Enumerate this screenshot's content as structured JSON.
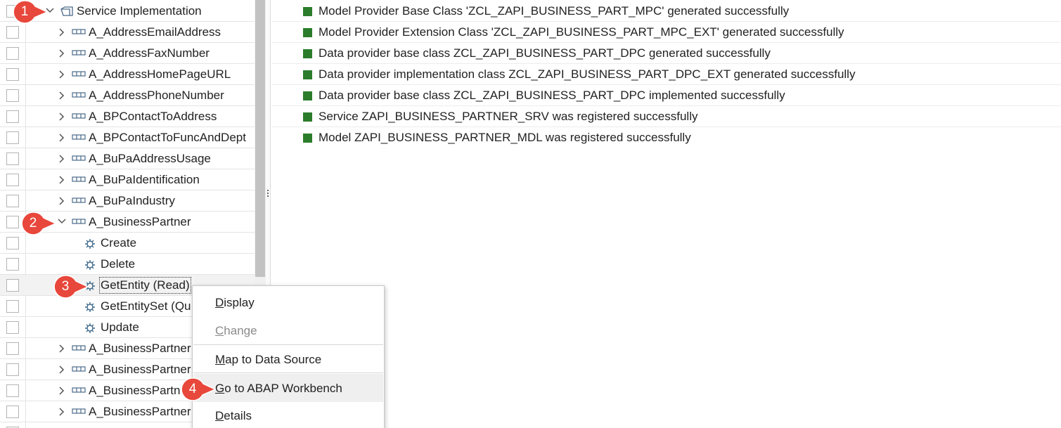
{
  "tree": {
    "root": {
      "label": "Service Implementation",
      "icon": "service-folder-icon"
    },
    "entities_before": [
      "A_AddressEmailAddress",
      "A_AddressFaxNumber",
      "A_AddressHomePageURL",
      "A_AddressPhoneNumber",
      "A_BPContactToAddress",
      "A_BPContactToFuncAndDept",
      "A_BuPaAddressUsage",
      "A_BuPaIdentification",
      "A_BuPaIndustry"
    ],
    "expanded_entity": "A_BusinessPartner",
    "operations": [
      "Create",
      "Delete",
      "GetEntity (Read)",
      "GetEntitySet (Qu",
      "Update"
    ],
    "selected_operation": "GetEntity (Read)",
    "entities_after": [
      "A_BusinessPartner",
      "A_BusinessPartner",
      "A_BusinessPartn",
      "A_BusinessPartner"
    ]
  },
  "messages": [
    {
      "status": "success",
      "text": "Model Provider Base Class 'ZCL_ZAPI_BUSINESS_PART_MPC' generated successfully"
    },
    {
      "status": "success",
      "text": "Model Provider Extension Class 'ZCL_ZAPI_BUSINESS_PART_MPC_EXT' generated successfully"
    },
    {
      "status": "success",
      "text": "Data provider base class ZCL_ZAPI_BUSINESS_PART_DPC generated successfully"
    },
    {
      "status": "success",
      "text": "Data provider implementation class ZCL_ZAPI_BUSINESS_PART_DPC_EXT generated successfully"
    },
    {
      "status": "success",
      "text": "Data provider base class ZCL_ZAPI_BUSINESS_PART_DPC implemented successfully"
    },
    {
      "status": "success",
      "text": "Service ZAPI_BUSINESS_PARTNER_SRV was registered successfully"
    },
    {
      "status": "success",
      "text": "Model ZAPI_BUSINESS_PARTNER_MDL was registered successfully"
    }
  ],
  "context_menu": {
    "display": {
      "accel": "D",
      "rest": "isplay",
      "enabled": true
    },
    "change": {
      "accel": "C",
      "rest": "hange",
      "enabled": false
    },
    "map": {
      "accel": "M",
      "rest": "ap to Data Source",
      "enabled": true
    },
    "goto": {
      "accel": "G",
      "rest": "o to ABAP Workbench",
      "enabled": true
    },
    "details": {
      "accel": "D",
      "rest": "etails",
      "enabled": true
    }
  },
  "badges": [
    "1",
    "2",
    "3",
    "4"
  ],
  "colors": {
    "success": "#2b7d2b",
    "badge": "#e8473b",
    "accent": "#0a6ed1"
  }
}
